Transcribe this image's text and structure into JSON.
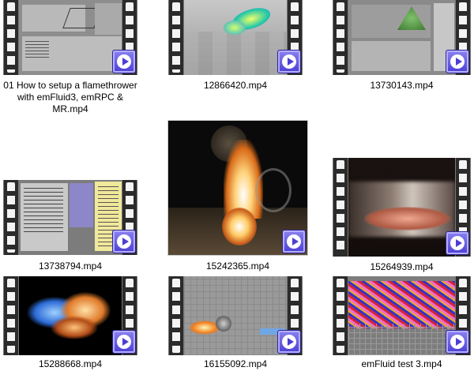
{
  "files": [
    {
      "name": "01 How to setup a flamethrower with emFluid3, emRPC & MR.mp4"
    },
    {
      "name": "12866420.mp4"
    },
    {
      "name": "13730143.mp4"
    },
    {
      "name": "13738794.mp4"
    },
    {
      "name": "15242365.mp4"
    },
    {
      "name": "15264939.mp4"
    },
    {
      "name": "15288668.mp4"
    },
    {
      "name": "16155092.mp4"
    },
    {
      "name": "emFluid test 3.mp4"
    }
  ]
}
